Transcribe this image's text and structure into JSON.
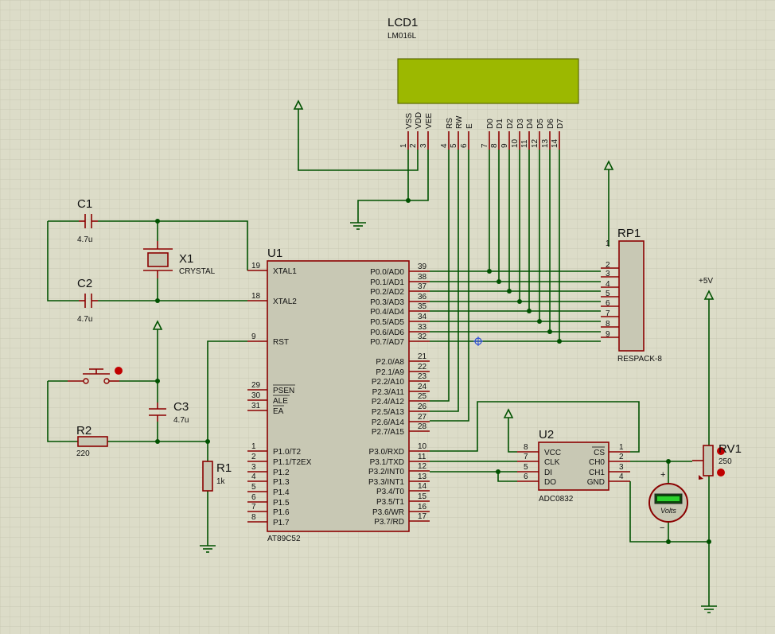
{
  "lcd": {
    "ref": "LCD1",
    "model": "LM016L",
    "pin_names": [
      "VSS",
      "VDD",
      "VEE",
      "RS",
      "RW",
      "E",
      "D0",
      "D1",
      "D2",
      "D3",
      "D4",
      "D5",
      "D6",
      "D7"
    ],
    "pin_nums": [
      "1",
      "2",
      "3",
      "4",
      "5",
      "6",
      "7",
      "8",
      "9",
      "10",
      "11",
      "12",
      "13",
      "14"
    ],
    "screen_color": "#9cb800"
  },
  "mcu": {
    "ref": "U1",
    "model": "AT89C52",
    "left_pins": [
      {
        "num": "19",
        "name": "XTAL1"
      },
      {
        "num": "18",
        "name": "XTAL2"
      },
      {
        "num": "9",
        "name": "RST"
      },
      {
        "num": "29",
        "name": "PSEN"
      },
      {
        "num": "30",
        "name": "ALE"
      },
      {
        "num": "31",
        "name": "EA"
      },
      {
        "num": "1",
        "name": "P1.0/T2"
      },
      {
        "num": "2",
        "name": "P1.1/T2EX"
      },
      {
        "num": "3",
        "name": "P1.2"
      },
      {
        "num": "4",
        "name": "P1.3"
      },
      {
        "num": "5",
        "name": "P1.4"
      },
      {
        "num": "6",
        "name": "P1.5"
      },
      {
        "num": "7",
        "name": "P1.6"
      },
      {
        "num": "8",
        "name": "P1.7"
      }
    ],
    "right_pins": [
      {
        "num": "39",
        "name": "P0.0/AD0"
      },
      {
        "num": "38",
        "name": "P0.1/AD1"
      },
      {
        "num": "37",
        "name": "P0.2/AD2"
      },
      {
        "num": "36",
        "name": "P0.3/AD3"
      },
      {
        "num": "35",
        "name": "P0.4/AD4"
      },
      {
        "num": "34",
        "name": "P0.5/AD5"
      },
      {
        "num": "33",
        "name": "P0.6/AD6"
      },
      {
        "num": "32",
        "name": "P0.7/AD7"
      },
      {
        "num": "21",
        "name": "P2.0/A8"
      },
      {
        "num": "22",
        "name": "P2.1/A9"
      },
      {
        "num": "23",
        "name": "P2.2/A10"
      },
      {
        "num": "24",
        "name": "P2.3/A11"
      },
      {
        "num": "25",
        "name": "P2.4/A12"
      },
      {
        "num": "26",
        "name": "P2.5/A13"
      },
      {
        "num": "27",
        "name": "P2.6/A14"
      },
      {
        "num": "28",
        "name": "P2.7/A15"
      },
      {
        "num": "10",
        "name": "P3.0/RXD"
      },
      {
        "num": "11",
        "name": "P3.1/TXD"
      },
      {
        "num": "12",
        "name": "P3.2/INT0"
      },
      {
        "num": "13",
        "name": "P3.3/INT1"
      },
      {
        "num": "14",
        "name": "P3.4/T0"
      },
      {
        "num": "15",
        "name": "P3.5/T1"
      },
      {
        "num": "16",
        "name": "P3.6/WR"
      },
      {
        "num": "17",
        "name": "P3.7/RD"
      }
    ]
  },
  "adc": {
    "ref": "U2",
    "model": "ADC0832",
    "left_pins": [
      {
        "num": "8",
        "name": "VCC"
      },
      {
        "num": "7",
        "name": "CLK"
      },
      {
        "num": "5",
        "name": "DI"
      },
      {
        "num": "6",
        "name": "DO"
      }
    ],
    "right_pins": [
      {
        "num": "1",
        "name": "CS"
      },
      {
        "num": "2",
        "name": "CH0"
      },
      {
        "num": "3",
        "name": "CH1"
      },
      {
        "num": "4",
        "name": "GND"
      }
    ]
  },
  "rp1": {
    "ref": "RP1",
    "model": "RESPACK-8",
    "pin_nums": [
      "1",
      "2",
      "3",
      "4",
      "5",
      "6",
      "7",
      "8",
      "9"
    ]
  },
  "c1": {
    "ref": "C1",
    "value": "4.7u"
  },
  "c2": {
    "ref": "C2",
    "value": "4.7u"
  },
  "c3": {
    "ref": "C3",
    "value": "4.7u"
  },
  "x1": {
    "ref": "X1",
    "value": "CRYSTAL"
  },
  "r1": {
    "ref": "R1",
    "value": "1k"
  },
  "r2": {
    "ref": "R2",
    "value": "220"
  },
  "rv1": {
    "ref": "RV1",
    "value": "250"
  },
  "supply": {
    "label": "+5V"
  },
  "voltmeter": {
    "label": "Volts",
    "plus": "+",
    "minus": "−"
  }
}
